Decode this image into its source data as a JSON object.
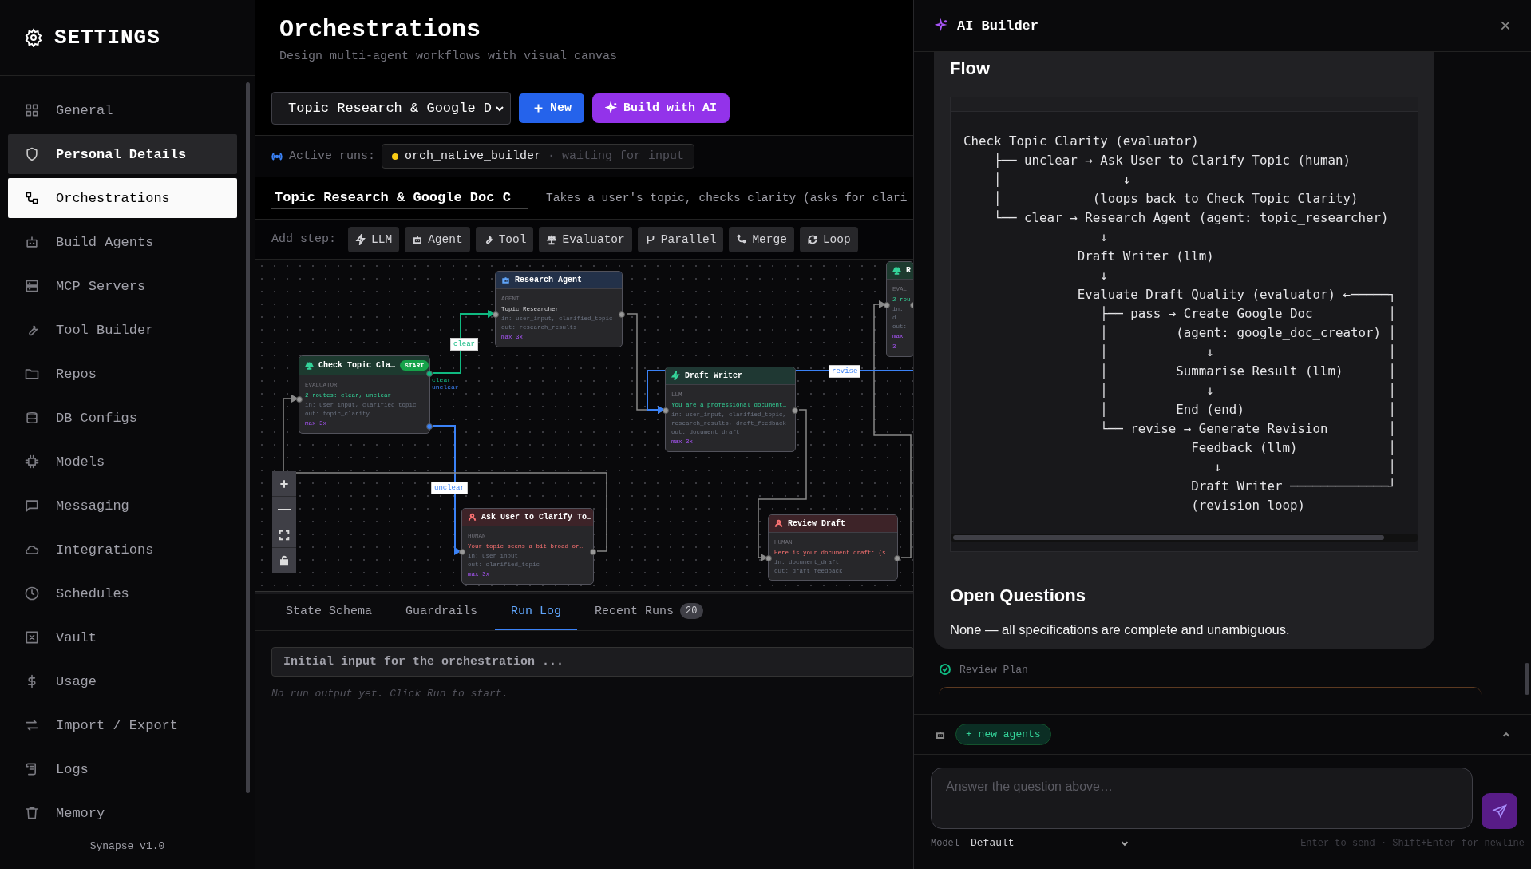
{
  "sidebar": {
    "title": "SETTINGS",
    "items": [
      {
        "label": "General",
        "selected": false,
        "hovered": false
      },
      {
        "label": "Personal Details",
        "selected": false,
        "hovered": true
      },
      {
        "label": "Orchestrations",
        "selected": true,
        "hovered": false
      },
      {
        "label": "Build Agents",
        "selected": false,
        "hovered": false
      },
      {
        "label": "MCP Servers",
        "selected": false,
        "hovered": false
      },
      {
        "label": "Tool Builder",
        "selected": false,
        "hovered": false
      },
      {
        "label": "Repos",
        "selected": false,
        "hovered": false
      },
      {
        "label": "DB Configs",
        "selected": false,
        "hovered": false
      },
      {
        "label": "Models",
        "selected": false,
        "hovered": false
      },
      {
        "label": "Messaging",
        "selected": false,
        "hovered": false
      },
      {
        "label": "Integrations",
        "selected": false,
        "hovered": false
      },
      {
        "label": "Schedules",
        "selected": false,
        "hovered": false
      },
      {
        "label": "Vault",
        "selected": false,
        "hovered": false
      },
      {
        "label": "Usage",
        "selected": false,
        "hovered": false
      },
      {
        "label": "Import / Export",
        "selected": false,
        "hovered": false
      },
      {
        "label": "Logs",
        "selected": false,
        "hovered": false
      },
      {
        "label": "Memory",
        "selected": false,
        "hovered": false
      }
    ],
    "footer": "Synapse v1.0"
  },
  "page": {
    "title": "Orchestrations",
    "subtitle": "Design multi-agent workflows with visual canvas"
  },
  "toolbar": {
    "select": "Topic Research & Google D",
    "new_button": "New",
    "ai_button": "Build with AI"
  },
  "active_runs": {
    "label": "Active runs:",
    "runs": [
      {
        "name": "orch_native_builder",
        "status": "· waiting for input",
        "color": "#facc15"
      }
    ]
  },
  "orchestration": {
    "name": "Topic Research & Google Doc C",
    "description": "Takes a user's topic, checks clarity (asks for clari"
  },
  "add_step": {
    "label": "Add step:",
    "buttons": [
      "LLM",
      "Agent",
      "Tool",
      "Evaluator",
      "Parallel",
      "Merge",
      "Loop"
    ]
  },
  "canvas": {
    "nodes": [
      {
        "kind": "evaluator",
        "title": "R",
        "type_label": "EVAL",
        "summary": "2 rou",
        "inputs": "in: d",
        "output": "out:",
        "max": "max 3"
      },
      {
        "kind": "evaluator",
        "title": "Check Topic Cla…",
        "badge": "START",
        "type_label": "EVALUATOR",
        "summary": "2 routes: clear, unclear",
        "inputs": "in: user_input, clarified_topic",
        "output": "out: topic_clarity",
        "max": "max 3x",
        "routes": [
          "clear",
          "unclear"
        ]
      },
      {
        "kind": "agent",
        "title": "Research Agent",
        "type_label": "AGENT",
        "summary": "Topic Researcher",
        "inputs": "in: user_input, clarified_topic",
        "output": "out: research_results",
        "max": "max 3x"
      },
      {
        "kind": "llm",
        "title": "Draft Writer",
        "type_label": "LLM",
        "summary": "You are a professional document…",
        "inputs": "in: user_input, clarified_topic, research_results, draft_feedback",
        "output": "out: document_draft",
        "max": "max 3x"
      },
      {
        "kind": "human",
        "title": "Ask User to Clarify To…",
        "type_label": "HUMAN",
        "summary": "Your topic seems a bit broad or…",
        "inputs": "in: user_input",
        "output": "out: clarified_topic",
        "max": "max 3x"
      },
      {
        "kind": "human",
        "title": "Review Draft",
        "type_label": "HUMAN",
        "summary": "Here is your document draft: (s…",
        "inputs": "in: document_draft",
        "output": "out: draft_feedback"
      }
    ],
    "edge_labels": [
      "clear",
      "unclear",
      "revise"
    ]
  },
  "bottom_tabs": [
    {
      "label": "State Schema",
      "selected": false
    },
    {
      "label": "Guardrails",
      "selected": false
    },
    {
      "label": "Run Log",
      "selected": true
    },
    {
      "label": "Recent Runs",
      "selected": false,
      "count": "20"
    }
  ],
  "run_log": {
    "input_placeholder": "Initial input for the orchestration ...",
    "empty_message": "No run output yet. Click Run to start."
  },
  "ai_builder": {
    "title": "AI Builder",
    "flow_heading": "Flow",
    "flow_lines": [
      "Check Topic Clarity (evaluator)",
      "    ├── unclear → Ask User to Clarify Topic (human)",
      "    │                ↓",
      "    │            (loops back to Check Topic Clarity)",
      "    └── clear → Research Agent (agent: topic_researcher)",
      "                  ↓",
      "               Draft Writer (llm)",
      "                  ↓",
      "               Evaluate Draft Quality (evaluator) ←─────┐",
      "                  ├── pass → Create Google Doc          │",
      "                  │         (agent: google_doc_creator) │",
      "                  │             ↓                       │",
      "                  │         Summarise Result (llm)      │",
      "                  │             ↓                       │",
      "                  │         End (end)                   │",
      "                  └── revise → Generate Revision        │",
      "                              Feedback (llm)            │",
      "                                 ↓                      │",
      "                              Draft Writer ─────────────┘",
      "                              (revision loop)"
    ],
    "questions_heading": "Open Questions",
    "questions_text": "None — all specifications are complete and unambiguous.",
    "review_step": {
      "label": "Review Plan",
      "done": true
    },
    "chips": [
      "+ new agents"
    ],
    "input_placeholder": "Answer the question above…",
    "model_label": "Model",
    "model_value": "Default",
    "hint": "Enter to send · Shift+Enter for newline"
  }
}
